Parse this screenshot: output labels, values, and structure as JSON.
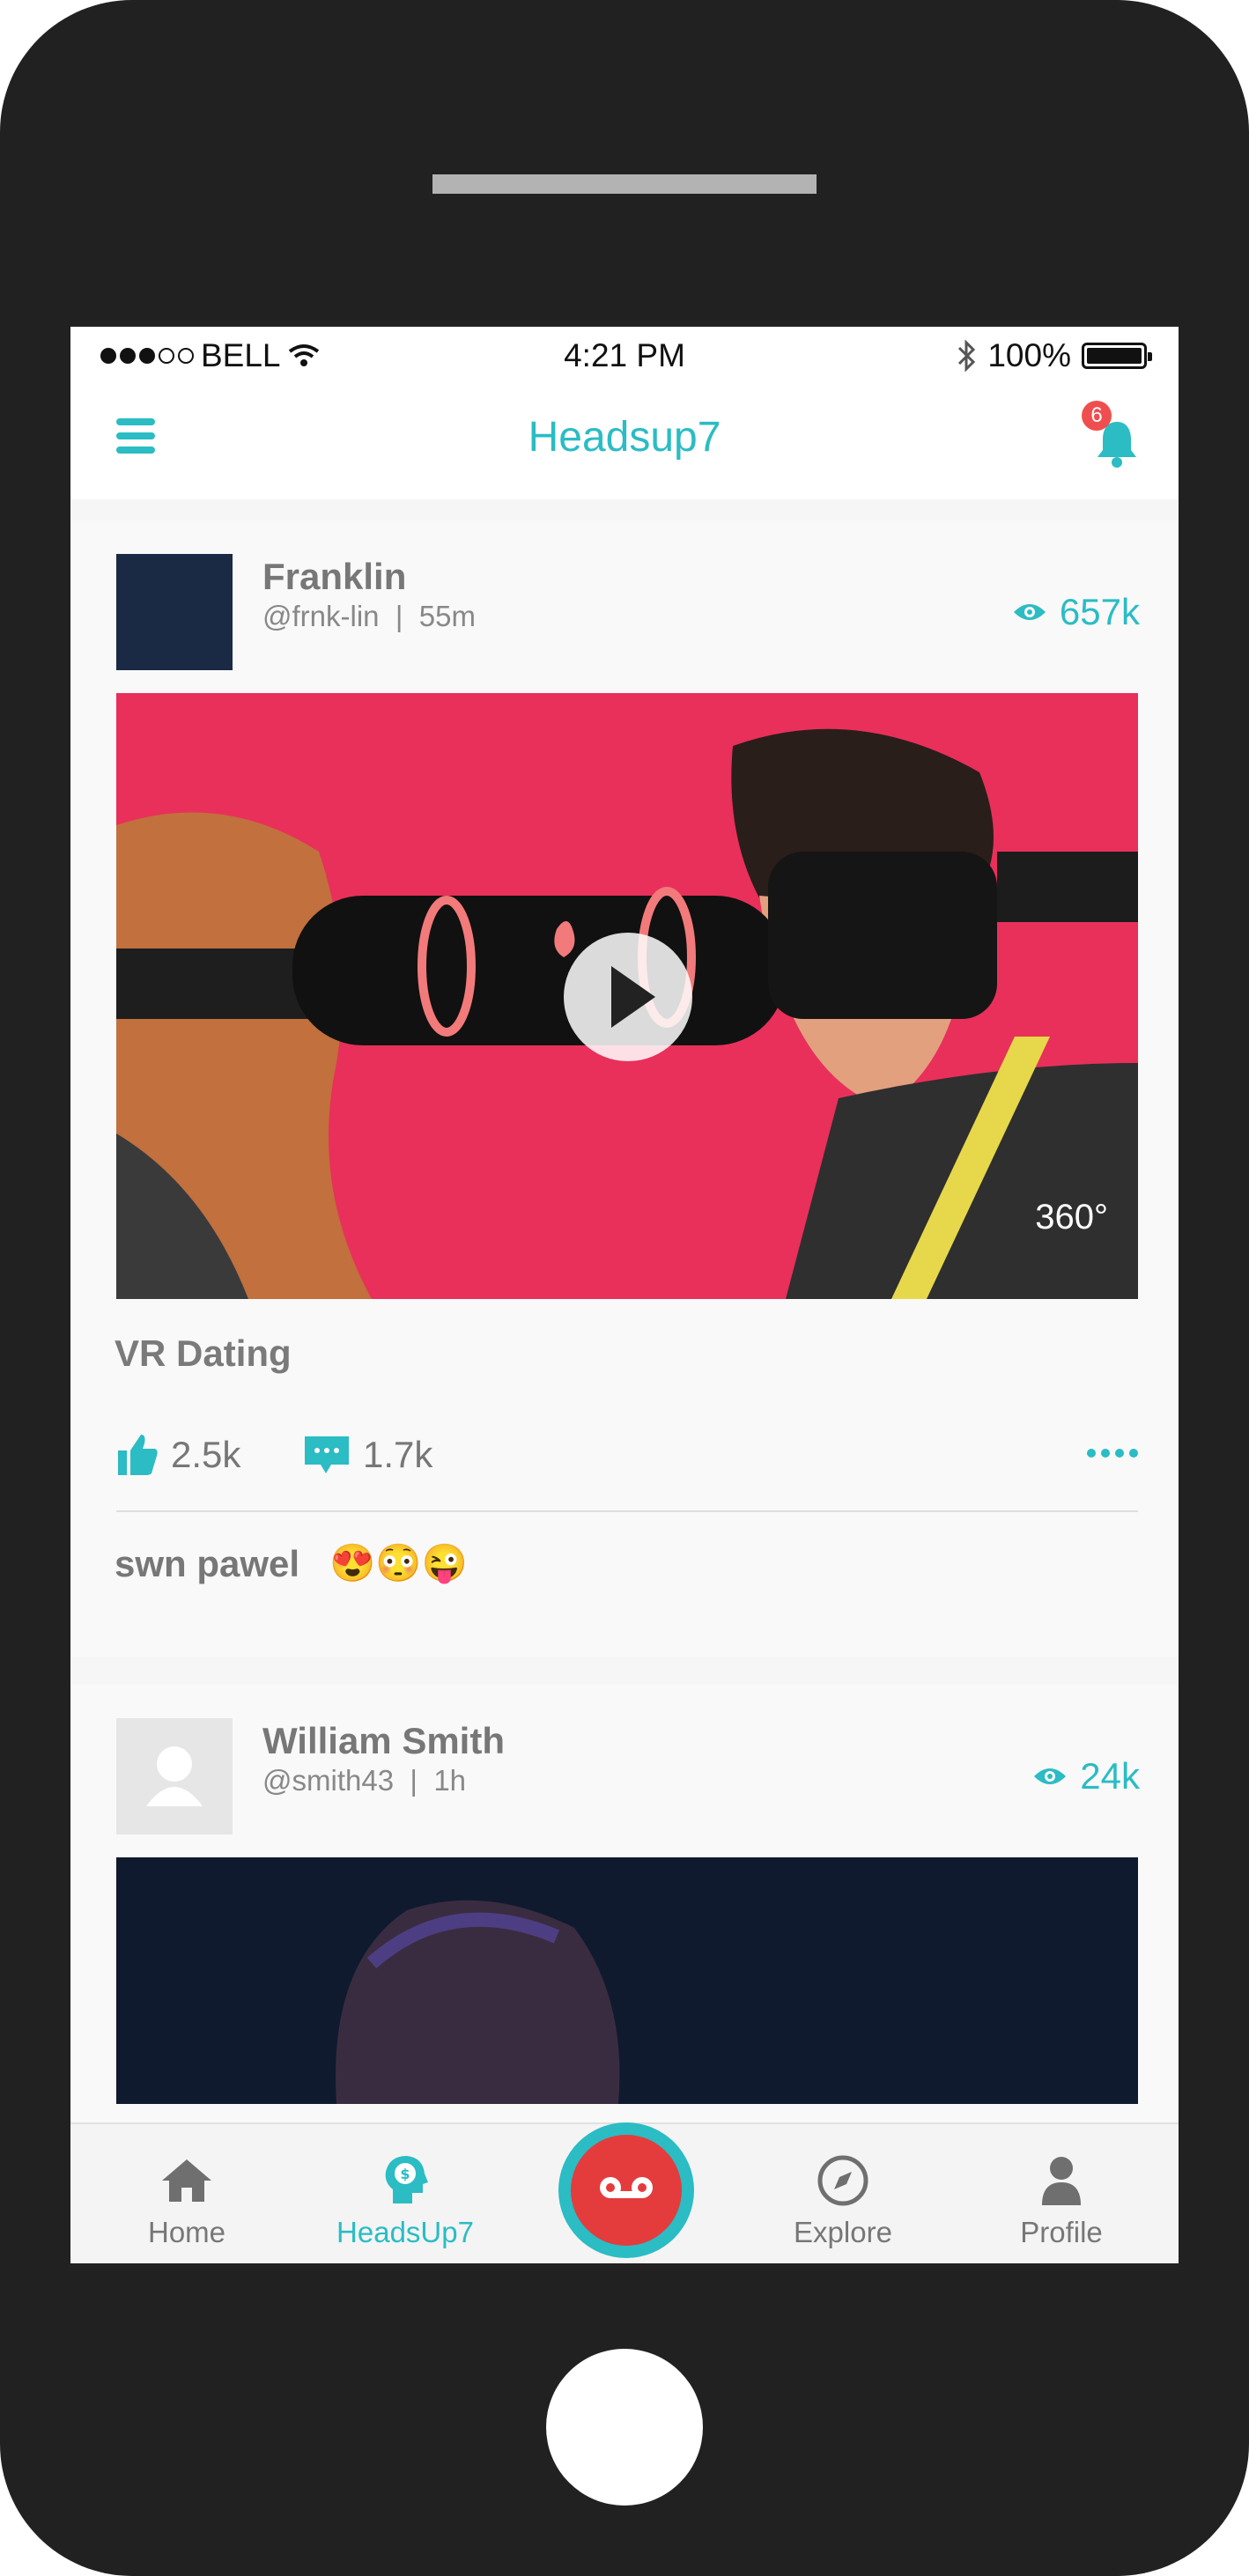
{
  "status_bar": {
    "carrier": "BELL",
    "time": "4:21 PM",
    "battery_percent": "100%",
    "signal_bars": 3
  },
  "header": {
    "title": "Headsup7",
    "notification_count": "6"
  },
  "posts": [
    {
      "author_name": "Franklin",
      "handle": "@frnk-lin",
      "time": "55m",
      "views": "657k",
      "media_label": "360°",
      "title": "VR Dating",
      "likes": "2.5k",
      "comments": "1.7k",
      "comment_author": "swn pawel",
      "comment_emojis": "😍😳😜"
    },
    {
      "author_name": "William Smith",
      "handle": "@smith43",
      "time": "1h",
      "views": "24k"
    }
  ],
  "tabbar": {
    "home": "Home",
    "headsup7": "HeadsUp7",
    "explore": "Explore",
    "profile": "Profile",
    "active": "headsup7"
  },
  "colors": {
    "accent": "#2bbcc4",
    "record": "#e43c3c",
    "badge": "#f04e4e",
    "device": "#222121"
  }
}
